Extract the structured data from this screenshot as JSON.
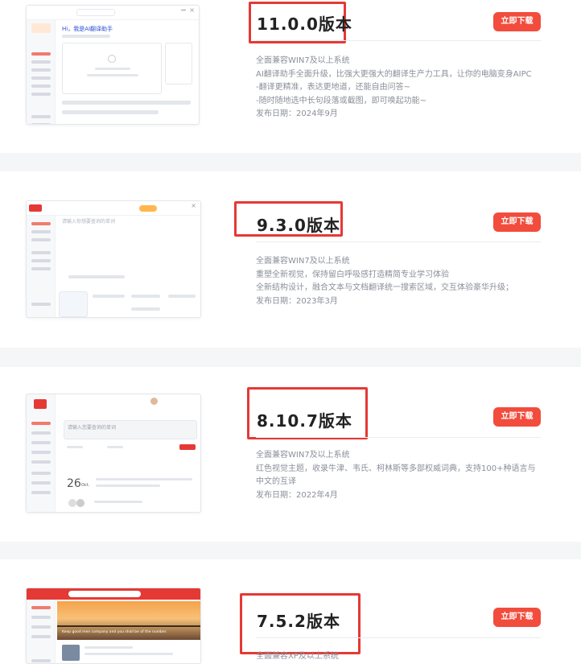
{
  "versions": [
    {
      "title": "11.0.0版本",
      "download_label": "立即下载",
      "lines": [
        "全面兼容WIN7及以上系统",
        "AI翻译助手全面升级，比强大更强大的翻译生产力工具，让你的电脑变身AIPC",
        "-翻译更精准，表达更地道，还能自由问答~",
        "-随时随地选中长句段落或截图，即可唤起功能~",
        "发布日期：2024年9月"
      ],
      "thumb_text": "Hi，我是AI翻译助手"
    },
    {
      "title": "9.3.0版本",
      "download_label": "立即下载",
      "lines": [
        "全面兼容WIN7及以上系统",
        "重塑全新视觉，保持留白呼吸感打造精简专业学习体验",
        "全新结构设计，融合文本与文档翻译统一搜索区域，交互体验豪华升级；",
        "发布日期：2023年3月"
      ],
      "thumb_text": "请输入你想要查询的单词"
    },
    {
      "title": "8.10.7版本",
      "download_label": "立即下载",
      "lines": [
        "全面兼容WIN7及以上系统",
        "红色视觉主题，收录牛津、韦氏、柯林斯等多部权威词典，支持100+种语言与",
        "中文的互译",
        "发布日期：2022年4月"
      ],
      "thumb_text": "请输入您要查询的单词",
      "thumb_date": "26",
      "thumb_month": "Oct."
    },
    {
      "title": "7.5.2版本",
      "download_label": "立即下载",
      "lines": [
        "全面兼容XP及以上系统"
      ],
      "thumb_text": "Keep good men company and you shall be of the number."
    }
  ],
  "colors": {
    "accent": "#f24c3d",
    "highlight_box": "#e53935"
  },
  "icons": [
    "window-minimize-icon",
    "window-close-icon",
    "search-icon",
    "avatar-icon"
  ]
}
